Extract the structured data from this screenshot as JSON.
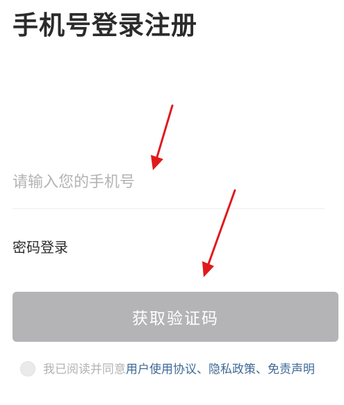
{
  "header": {
    "title": "手机号登录注册"
  },
  "phone": {
    "placeholder": "请输入您的手机号",
    "value": ""
  },
  "password_login_label": "密码登录",
  "get_code_button_label": "获取验证码",
  "agreement": {
    "prefix": "我已阅读并同意",
    "user_agreement": "用户使用协议",
    "sep1": "、",
    "privacy_policy": "隐私政策",
    "sep2": "、",
    "disclaimer": "免责声明",
    "checked": false
  },
  "colors": {
    "title": "#2b2b2b",
    "placeholder": "#b3b3b3",
    "button_bg": "#b4b4b7",
    "link": "#3f6a96",
    "annotation_arrow": "#e0191c"
  },
  "icons": {
    "agree_checkbox": "circle-checkbox-icon",
    "annotation": "red-arrow-icon"
  }
}
